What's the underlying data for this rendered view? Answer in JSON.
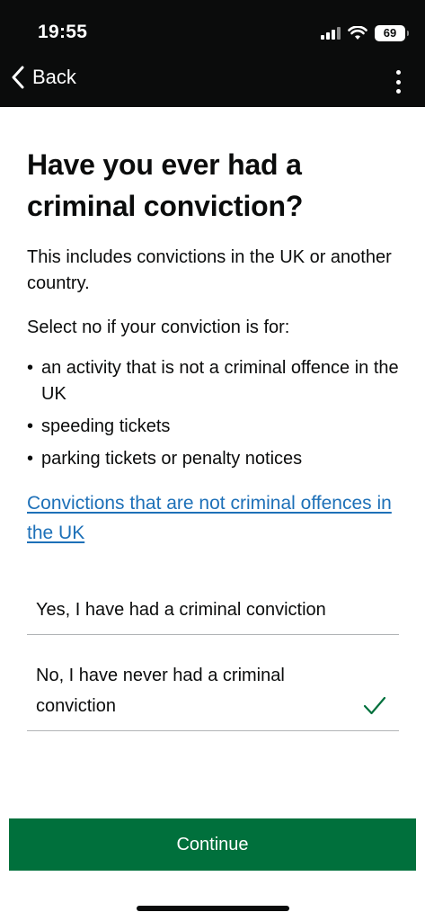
{
  "status_bar": {
    "time": "19:55",
    "battery": "69"
  },
  "nav": {
    "back_label": "Back",
    "menu_icon": "more-vertical-icon"
  },
  "question": {
    "title": "Have you ever had a criminal conviction?",
    "intro": "This includes convictions in the UK or another country.",
    "select_no_text": "Select no if your conviction is for:",
    "bullets": [
      "an activity that is not a criminal offence in the UK",
      "speeding tickets",
      "parking tickets or penalty notices"
    ],
    "link_text": "Convictions that are not criminal offences in the UK"
  },
  "options": [
    {
      "label": "Yes, I have had a criminal conviction",
      "selected": false
    },
    {
      "label": "No, I have never had a criminal conviction",
      "selected": true
    }
  ],
  "continue_label": "Continue",
  "colors": {
    "header_bg": "#0b0c0c",
    "link": "#1d70b8",
    "button": "#00703c",
    "check": "#00703c"
  }
}
